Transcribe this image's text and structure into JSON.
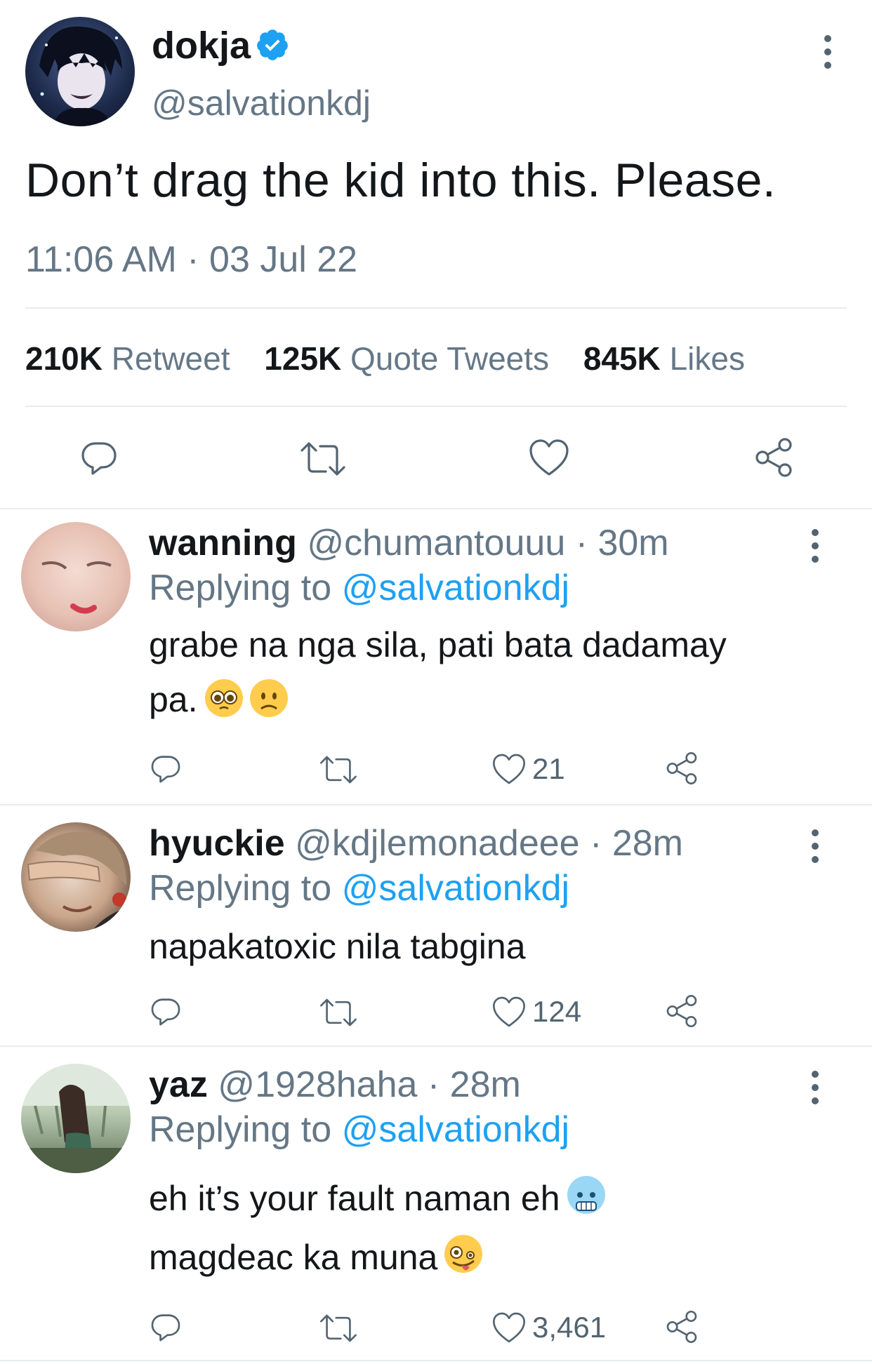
{
  "main_tweet": {
    "author_name": "dokja",
    "handle": "@salvationkdj",
    "verified": true,
    "text": "Don’t drag the kid into this. Please.",
    "timestamp": "11:06 AM · 03 Jul 22",
    "stats": [
      {
        "count": "210K",
        "label": "Retweet"
      },
      {
        "count": "125K",
        "label": "Quote Tweets"
      },
      {
        "count": "845K",
        "label": "Likes"
      }
    ],
    "actions": [
      "reply-icon",
      "retweet-icon",
      "like-icon",
      "share-icon"
    ]
  },
  "replies": [
    {
      "name": "wanning",
      "handle": "@chumantouuu",
      "time": "· 30m",
      "replying_prefix": "Replying to",
      "replying_to": "@salvationkdj",
      "text_line1": "grabe na nga sila, pati bata dadamay",
      "text_line2": "pa.",
      "emojis": [
        "pleading-face-emoji",
        "slightly-frowning-face-emoji"
      ],
      "likes": "21"
    },
    {
      "name": "hyuckie",
      "handle": "@kdjlemonadeee",
      "time": "· 28m",
      "replying_prefix": "Replying to",
      "replying_to": "@salvationkdj",
      "text_line1": "napakatoxic nila tabgina",
      "likes": "124"
    },
    {
      "name": "yaz",
      "handle": "@1928haha",
      "time": "· 28m",
      "replying_prefix": "Replying to",
      "replying_to": "@salvationkdj",
      "text_line1": "eh it’s your fault naman eh",
      "text_line2": "magdeac ka muna",
      "emojis": [
        "cold-face-emoji",
        "zany-face-emoji"
      ],
      "likes": "3,461"
    }
  ],
  "colors": {
    "link": "#1da1f2",
    "verified": "#1da1f2",
    "secondary_text": "#657786",
    "divider": "#e6ecf0"
  }
}
